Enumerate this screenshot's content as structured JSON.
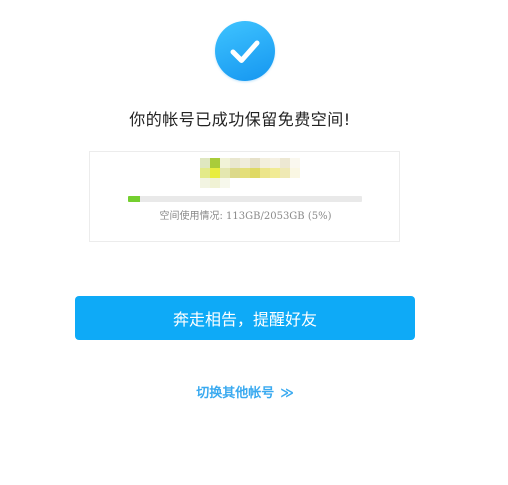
{
  "success": {
    "title": "你的帐号已成功保留免费空间!"
  },
  "account": {
    "name_masked": true
  },
  "storage": {
    "label_prefix": "空间使用情况: ",
    "used": "113GB",
    "separator": "/",
    "total": "2053GB",
    "percent_text": " (5%)",
    "usage_fraction": 0.05,
    "fill_color": "#74cf2f"
  },
  "actions": {
    "share_button_label": "奔走相告，提醒好友",
    "switch_link_label": "切换其他帐号",
    "switch_link_chevron": "≫"
  },
  "colors": {
    "accent": "#0eaaf7",
    "link": "#3aaaf0"
  },
  "icons": {
    "success": "check-circle-icon",
    "chevron": "double-chevron-right-icon"
  }
}
